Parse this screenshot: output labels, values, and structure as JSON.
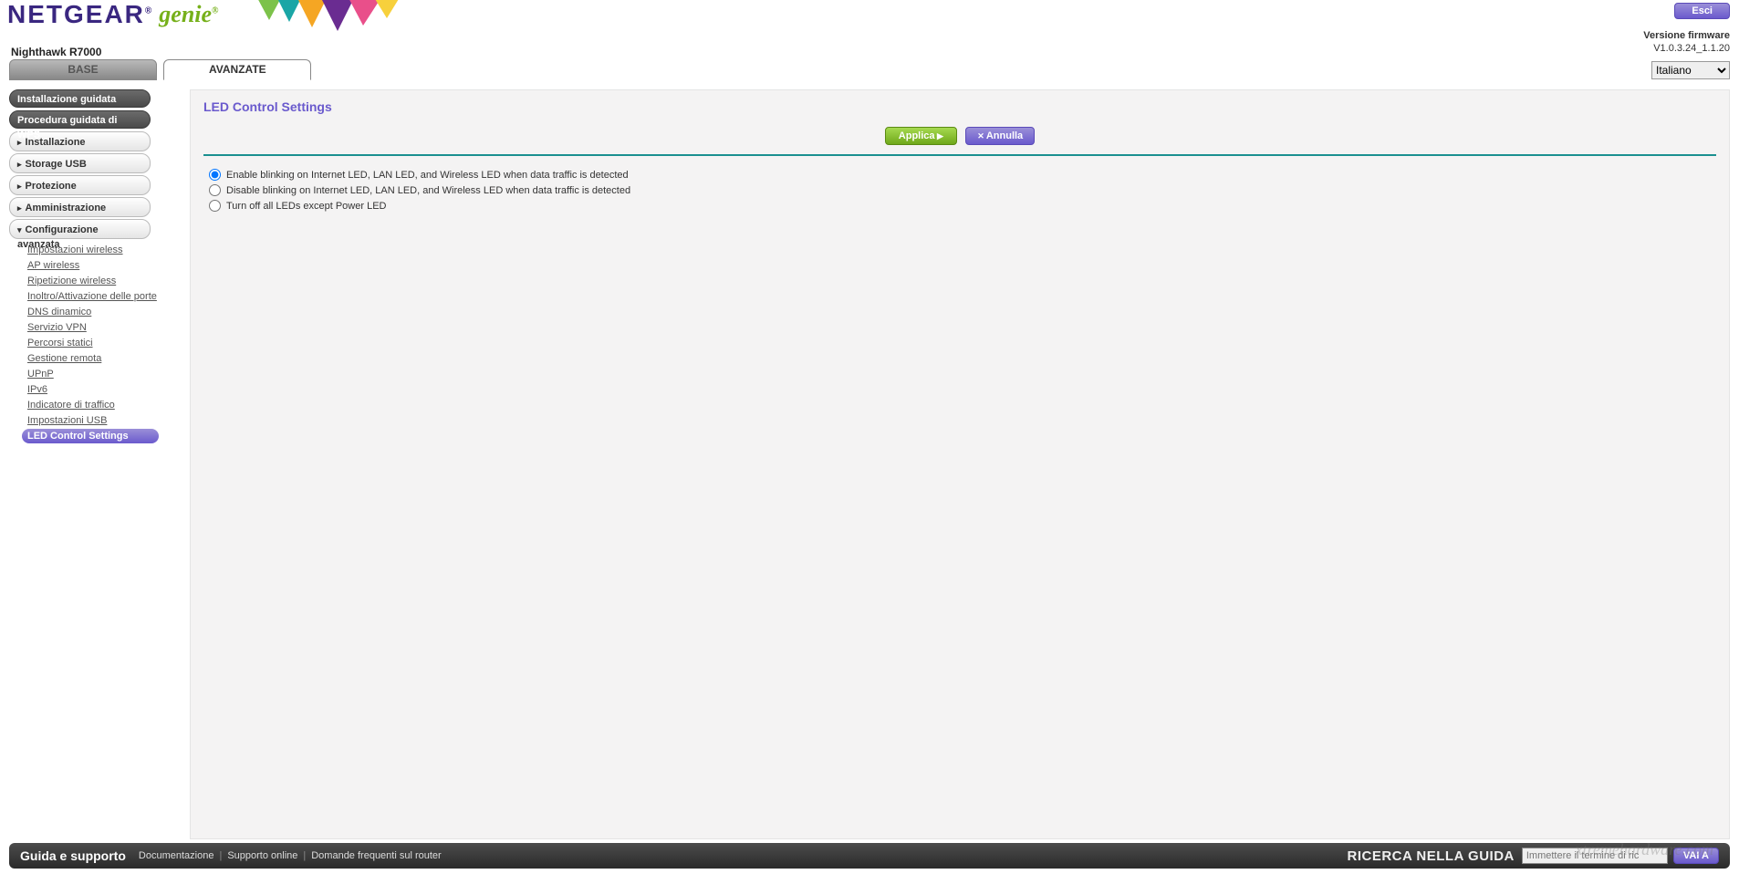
{
  "header": {
    "brand_primary": "NETGEAR",
    "brand_secondary": "genie",
    "model": "Nighthawk R7000",
    "logout": "Esci",
    "firmware_label": "Versione firmware",
    "firmware_version": "V1.0.3.24_1.1.20",
    "language_selected": "Italiano"
  },
  "tabs": {
    "base": "BASE",
    "advanced": "AVANZATE"
  },
  "sidebar": {
    "install_wizard": "Installazione guidata",
    "wps_wizard": "Procedura guidata di WPS",
    "cats": {
      "install": "Installazione",
      "usb": "Storage USB",
      "protection": "Protezione",
      "admin": "Amministrazione",
      "advcfg": "Configurazione avanzata"
    },
    "adv_items": [
      "Impostazioni wireless",
      "AP wireless",
      "Ripetizione wireless",
      "Inoltro/Attivazione delle porte",
      "DNS dinamico",
      "Servizio VPN",
      "Percorsi statici",
      "Gestione remota",
      "UPnP",
      "IPv6",
      "Indicatore di traffico",
      "Impostazioni USB",
      "LED Control Settings"
    ]
  },
  "content": {
    "title": "LED Control Settings",
    "apply": "Applica",
    "cancel": "Annulla",
    "options": [
      "Enable blinking on Internet LED, LAN LED, and Wireless LED when data traffic is detected",
      "Disable blinking on Internet LED, LAN LED, and Wireless LED when data traffic is detected",
      "Turn off all LEDs except Power LED"
    ],
    "selected_index": 0
  },
  "footer": {
    "title": "Guida e supporto",
    "links": [
      "Documentazione",
      "Supporto online",
      "Domande frequenti sul router"
    ],
    "search_label": "RICERCA NELLA GUIDA",
    "search_placeholder": "Immettere il termine di ric",
    "go": "VAI A"
  },
  "watermark": "xtremehardware.com"
}
